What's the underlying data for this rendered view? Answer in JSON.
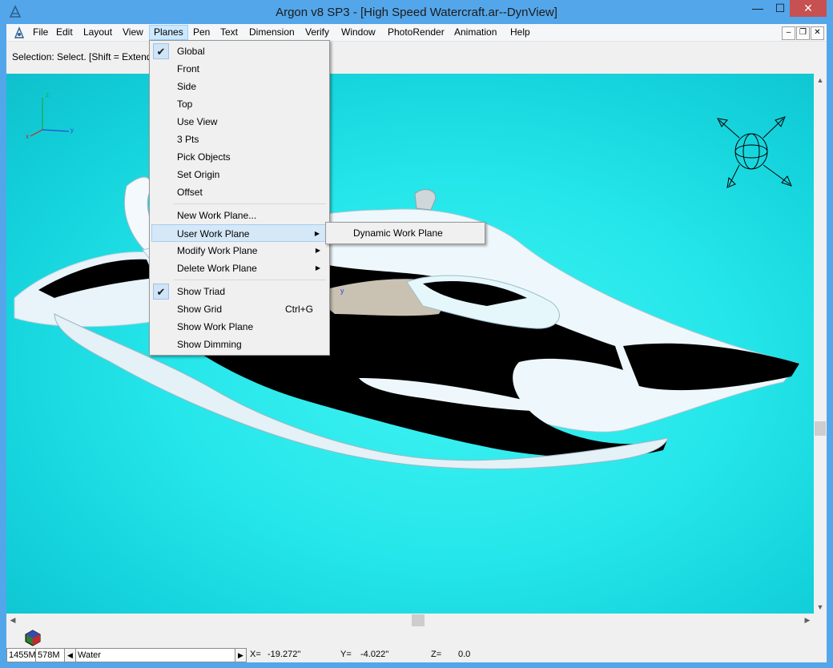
{
  "window": {
    "title": "Argon v8 SP3 - [High Speed Watercraft.ar--DynView]",
    "minimize_glyph": "—",
    "maximize_glyph": "☐",
    "close_glyph": "✕"
  },
  "menubar": {
    "items": [
      {
        "label": "File"
      },
      {
        "label": "Edit"
      },
      {
        "label": "Layout"
      },
      {
        "label": "View"
      },
      {
        "label": "Planes"
      },
      {
        "label": "Pen"
      },
      {
        "label": "Text"
      },
      {
        "label": "Dimension"
      },
      {
        "label": "Verify"
      },
      {
        "label": "Window"
      },
      {
        "label": "PhotoRender"
      },
      {
        "label": "Animation"
      },
      {
        "label": "Help"
      }
    ],
    "active": "Planes",
    "mdi_minimize": "–",
    "mdi_restore": "❐",
    "mdi_close": "✕"
  },
  "selection_bar": {
    "text": "Selection: Select. [Shift = Extend] [C"
  },
  "planes_menu": {
    "items": [
      {
        "label": "Global",
        "checked": true
      },
      {
        "label": "Front"
      },
      {
        "label": "Side"
      },
      {
        "label": "Top"
      },
      {
        "label": "Use View"
      },
      {
        "label": "3 Pts"
      },
      {
        "label": "Pick Objects"
      },
      {
        "label": "Set Origin"
      },
      {
        "label": "Offset"
      },
      {
        "label": "New Work Plane..."
      },
      {
        "label": "User Work Plane",
        "submenu": true,
        "highlighted": true
      },
      {
        "label": "Modify Work Plane",
        "submenu": true
      },
      {
        "label": "Delete Work Plane",
        "submenu": true
      },
      {
        "label": "Show Triad",
        "checked": true
      },
      {
        "label": "Show Grid",
        "shortcut": "Ctrl+G"
      },
      {
        "label": "Show Work Plane"
      },
      {
        "label": "Show Dimming"
      }
    ],
    "check_glyph": "✔",
    "submenu_glyph": "▶"
  },
  "user_work_plane_submenu": {
    "items": [
      {
        "label": "Dynamic Work Plane"
      }
    ]
  },
  "viewport": {
    "triad_labels": {
      "z": "z",
      "x": "x",
      "y": "y"
    },
    "stray_axis_label": "y",
    "background_color": "#25e6ea"
  },
  "statusbar": {
    "memory_1": "1455M",
    "memory_2": "578M",
    "layer": "Water",
    "x_label": "X=",
    "x_value": "-19.272''",
    "y_label": "Y=",
    "y_value": "-4.022''",
    "z_label": "Z=",
    "z_value": "0.0"
  }
}
